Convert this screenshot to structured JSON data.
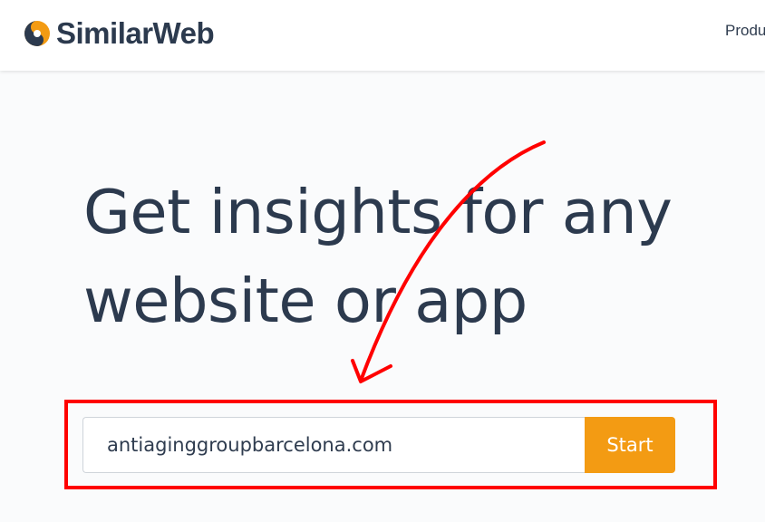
{
  "header": {
    "logo_text": "SimilarWeb",
    "logo_icon": "similarweb-logo-icon",
    "nav_item": "Produ"
  },
  "hero": {
    "headline_line1": "Get insights for any",
    "headline_line2": "website or app"
  },
  "search": {
    "value": "antiaginggroupbarcelona.com",
    "button_label": "Start"
  },
  "annotation": {
    "arrow": "red-arrow-icon",
    "highlight": "red-highlight-box"
  },
  "colors": {
    "brand_dark": "#2c3a4e",
    "brand_orange": "#f39b13",
    "annotation_red": "#ff0000",
    "page_bg": "#fafbfc"
  }
}
